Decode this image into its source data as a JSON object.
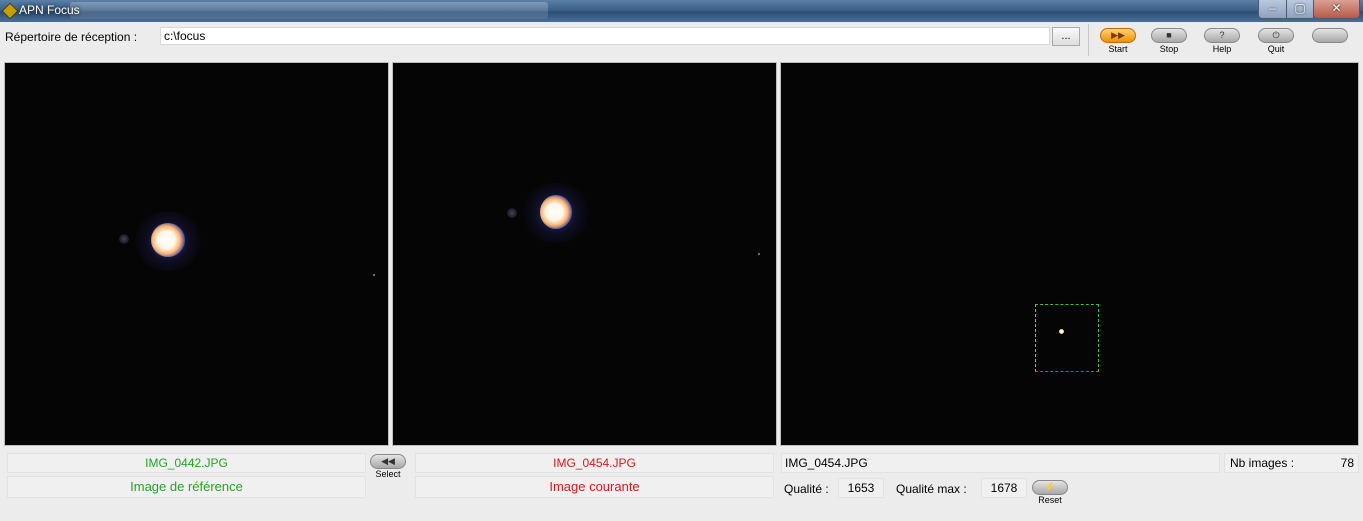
{
  "window": {
    "title": "APN Focus",
    "controls": {
      "minimize": "‒",
      "maximize": "▢",
      "close": "✕"
    }
  },
  "toolbar": {
    "directory_label": "Répertoire de réception :",
    "directory_value": "c:\\focus",
    "browse_label": "...",
    "buttons": [
      {
        "id": "start",
        "label": "Start",
        "icon": "fast-forward-icon",
        "glyph": "▶▶"
      },
      {
        "id": "stop",
        "label": "Stop",
        "icon": "stop-icon",
        "glyph": "■"
      },
      {
        "id": "help",
        "label": "Help",
        "icon": "question-icon",
        "glyph": "?"
      },
      {
        "id": "quit",
        "label": "Quit",
        "icon": "power-icon",
        "glyph": "⏻"
      },
      {
        "id": "blank",
        "label": "",
        "icon": "blank-button-icon",
        "glyph": ""
      }
    ]
  },
  "reference": {
    "filename": "IMG_0442.JPG",
    "label": "Image de référence"
  },
  "current": {
    "filename": "IMG_0454.JPG",
    "label": "Image courante"
  },
  "select_button": {
    "label": "Select",
    "glyph": "◀◀"
  },
  "full_view": {
    "filename": "IMG_0454.JPG",
    "nb_images_label": "Nb images :",
    "nb_images_value": "78"
  },
  "quality": {
    "label": "Qualité :",
    "value": "1653",
    "max_label": "Qualité max :",
    "max_value": "1678"
  },
  "reset_button": {
    "label": "Reset",
    "glyph": "⚡"
  },
  "colors": {
    "reference_text": "#22a722",
    "current_text": "#e01818",
    "start_button": "#f09000"
  }
}
